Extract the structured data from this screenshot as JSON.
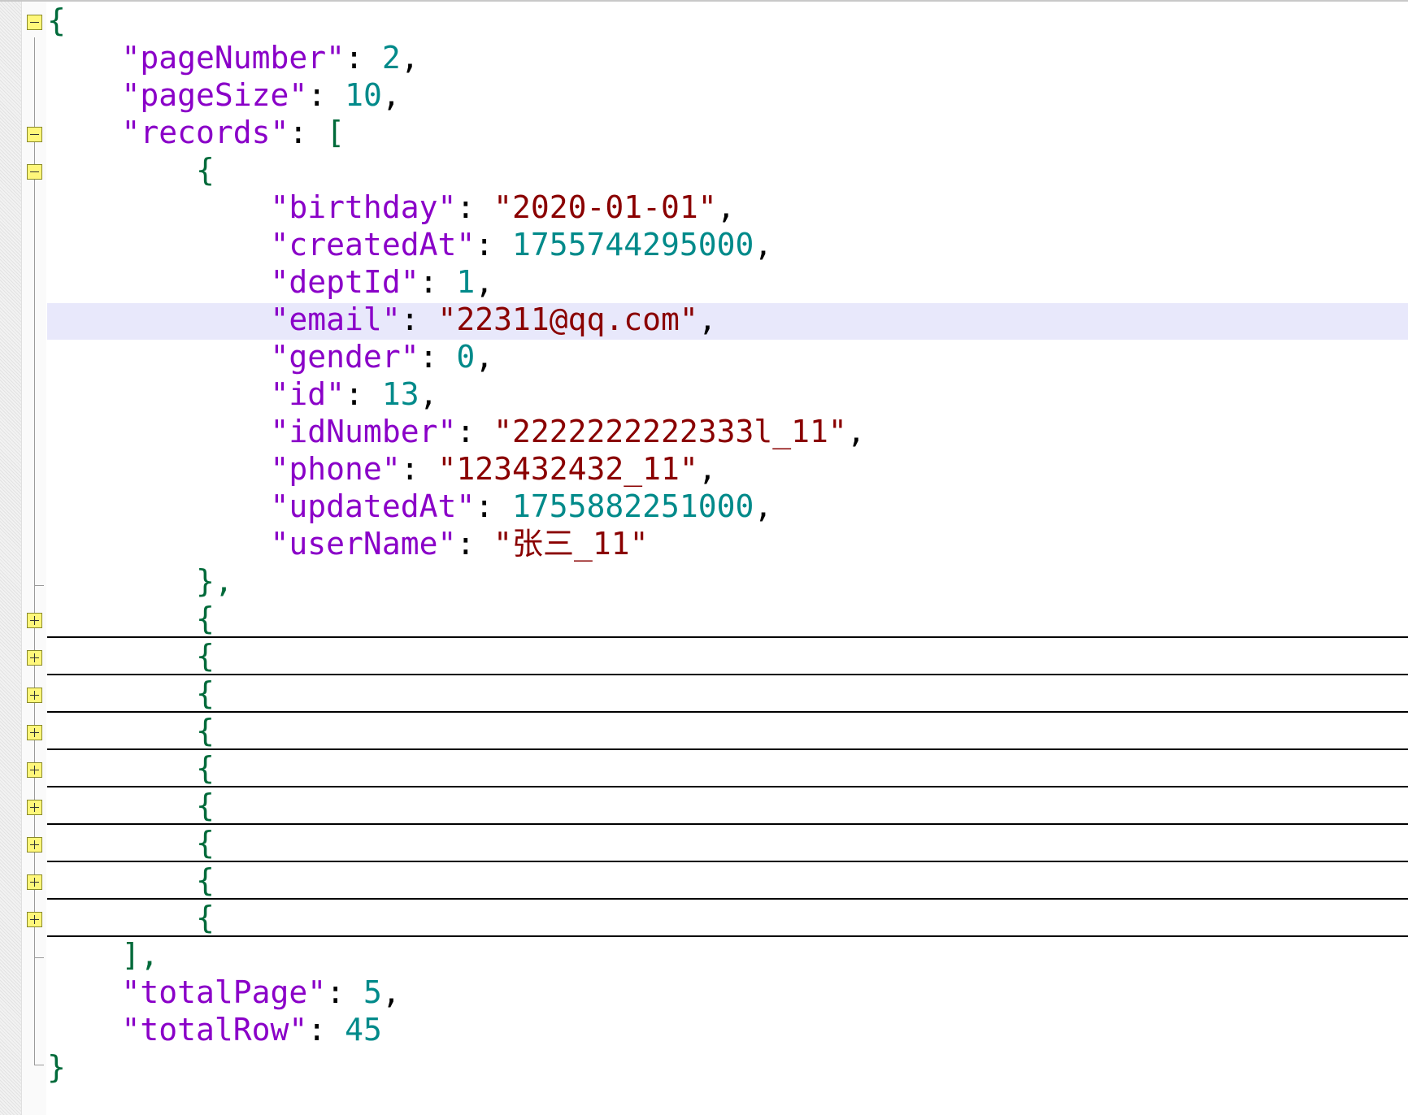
{
  "editor": {
    "root_open": "{",
    "page_number": {
      "key": "\"pageNumber\"",
      "value": "2"
    },
    "page_size": {
      "key": "\"pageSize\"",
      "value": "10"
    },
    "records": {
      "key": "\"records\"",
      "open": "[",
      "close": "],"
    },
    "record": {
      "open": "{",
      "close": "},",
      "fields": [
        {
          "key": "\"birthday\"",
          "value": "\"2020-01-01\"",
          "kind": "string"
        },
        {
          "key": "\"createdAt\"",
          "value": "1755744295000",
          "kind": "number"
        },
        {
          "key": "\"deptId\"",
          "value": "1",
          "kind": "number"
        },
        {
          "key": "\"email\"",
          "value": "\"22311@qq.com\"",
          "kind": "string"
        },
        {
          "key": "\"gender\"",
          "value": "0",
          "kind": "number"
        },
        {
          "key": "\"id\"",
          "value": "13",
          "kind": "number"
        },
        {
          "key": "\"idNumber\"",
          "value": "\"2222222222333l_11\"",
          "kind": "string"
        },
        {
          "key": "\"phone\"",
          "value": "\"123432432_11\"",
          "kind": "string"
        },
        {
          "key": "\"updatedAt\"",
          "value": "1755882251000",
          "kind": "number"
        },
        {
          "key": "\"userName\"",
          "value": "\"张三_11\"",
          "kind": "string"
        }
      ]
    },
    "collapsed_record_open": "{",
    "collapsed_record_count": 9,
    "total_page": {
      "key": "\"totalPage\"",
      "value": "5"
    },
    "total_row": {
      "key": "\"totalRow\"",
      "value": "45"
    },
    "root_close": "}",
    "highlighted_field": "email"
  },
  "colors": {
    "key": "#8a00c8",
    "string": "#8a0000",
    "number": "#008a8a",
    "bracket": "#006a3a",
    "current_line": "#e8e8fb",
    "fold_button": "#fff77a"
  },
  "icons": {
    "fold_expanded": "minus-box-icon",
    "fold_collapsed": "plus-box-icon"
  }
}
